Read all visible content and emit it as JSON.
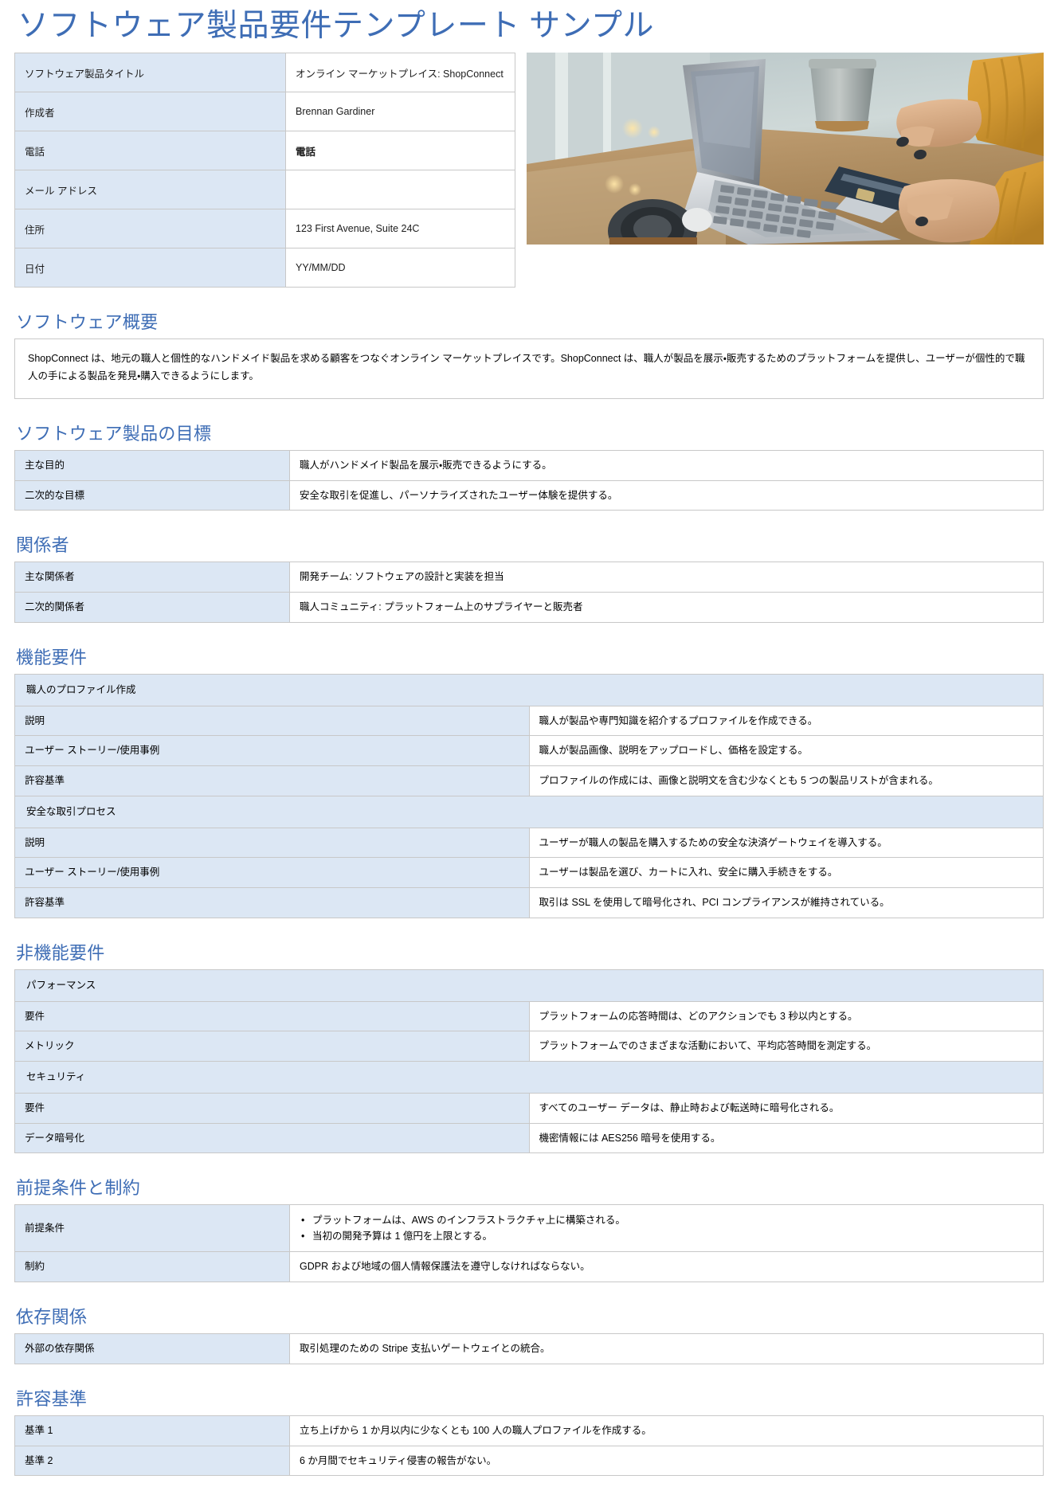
{
  "document": {
    "title": "ソフトウェア製品要件テンプレート サンプル",
    "accent_color": "#3E6DB5",
    "label_cell_color": "#DCE7F4",
    "border_color": "#C8C8C8"
  },
  "header_info": {
    "rows": [
      {
        "label": "ソフトウェア製品タイトル",
        "value": "オンライン マーケットプレイス: ShopConnect",
        "bold": false
      },
      {
        "label": "作成者",
        "value": "Brennan Gardiner",
        "bold": false
      },
      {
        "label": "電話",
        "value": "電話",
        "bold": true
      },
      {
        "label": "メール アドレス",
        "value": "",
        "bold": false
      },
      {
        "label": "住所",
        "value": "123 First Avenue, Suite 24C",
        "bold": false
      },
      {
        "label": "日付",
        "value": "YY/MM/DD",
        "bold": false
      }
    ]
  },
  "hero_image": {
    "alt": "ノートパソコンでクレジットカードを使ってオンラインショッピングをする人の写真"
  },
  "sections": {
    "overview": {
      "heading": "ソフトウェア概要",
      "paragraph": "ShopConnect は、地元の職人と個性的なハンドメイド製品を求める顧客をつなぐオンライン マーケットプレイスです。ShopConnect は、職人が製品を展示・販売するためのプラットフォームを提供し、ユーザーが個性的で職人の手による製品を発見・購入できるようにします。"
    },
    "goals": {
      "heading": "ソフトウェア製品の目標",
      "rows": [
        {
          "label": "主な目的",
          "value": "職人がハンドメイド製品を展示・販売できるようにする。"
        },
        {
          "label": "二次的な目標",
          "value": "安全な取引を促進し、パーソナライズされたユーザー体験を提供する。"
        }
      ]
    },
    "stakeholders": {
      "heading": "関係者",
      "rows": [
        {
          "label": "主な関係者",
          "value": "開発チーム: ソフトウェアの設計と実装を担当"
        },
        {
          "label": "二次的関係者",
          "value": "職人コミュニティ: プラットフォーム上のサプライヤーと販売者"
        }
      ]
    },
    "functional_requirements": {
      "heading": "機能要件",
      "groups": [
        {
          "group_title": "職人のプロファイル作成",
          "rows": [
            {
              "label": "説明",
              "value": "職人が製品や専門知識を紹介するプロファイルを作成できる。"
            },
            {
              "label": "ユーザー ストーリー/使用事例",
              "value": "職人が製品画像、説明をアップロードし、価格を設定する。"
            },
            {
              "label": "許容基準",
              "value": "プロファイルの作成には、画像と説明文を含む少なくとも 5 つの製品リストが含まれる。"
            }
          ]
        },
        {
          "group_title": "安全な取引プロセス",
          "rows": [
            {
              "label": "説明",
              "value": "ユーザーが職人の製品を購入するための安全な決済ゲートウェイを導入する。"
            },
            {
              "label": "ユーザー ストーリー/使用事例",
              "value": "ユーザーは製品を選び、カートに入れ、安全に購入手続きをする。"
            },
            {
              "label": "許容基準",
              "value": "取引は SSL を使用して暗号化され、PCI コンプライアンスが維持されている。"
            }
          ]
        }
      ]
    },
    "nonfunctional_requirements": {
      "heading": "非機能要件",
      "groups": [
        {
          "group_title": "パフォーマンス",
          "rows": [
            {
              "label": "要件",
              "value": "プラットフォームの応答時間は、どのアクションでも 3 秒以内とする。"
            },
            {
              "label": "メトリック",
              "value": "プラットフォームでのさまざまな活動において、平均応答時間を測定する。"
            }
          ]
        },
        {
          "group_title": "セキュリティ",
          "rows": [
            {
              "label": "要件",
              "value": "すべてのユーザー データは、静止時および転送時に暗号化される。"
            },
            {
              "label": "データ暗号化",
              "value": "機密情報には AES256 暗号を使用する。"
            }
          ]
        }
      ]
    },
    "assumptions_constraints": {
      "heading": "前提条件と制約",
      "assumptions_label": "前提条件",
      "assumptions_bullets": [
        "プラットフォームは、AWS のインフラストラクチャ上に構築される。",
        "当初の開発予算は 1 億円を上限とする。"
      ],
      "constraint_label": "制約",
      "constraint_value": "GDPR および地域の個人情報保護法を遵守しなければならない。"
    },
    "dependencies": {
      "heading": "依存関係",
      "rows": [
        {
          "label": "外部の依存関係",
          "value": "取引処理のための Stripe 支払いゲートウェイとの統合。"
        }
      ]
    },
    "acceptance_criteria": {
      "heading": "許容基準",
      "rows": [
        {
          "label": "基準 1",
          "value": "立ち上げから 1 か月以内に少なくとも 100 人の職人プロファイルを作成する。"
        },
        {
          "label": "基準 2",
          "value": "6 か月間でセキュリティ侵害の報告がない。"
        }
      ]
    }
  }
}
